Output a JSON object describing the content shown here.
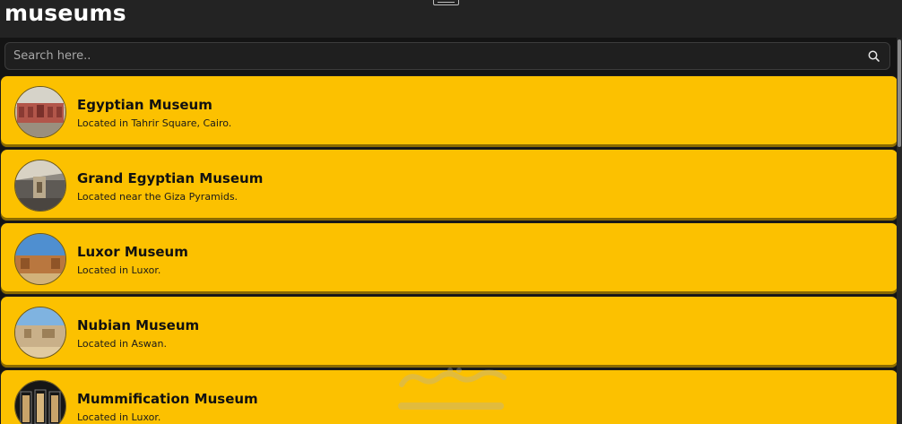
{
  "header": {
    "title": "museums",
    "menu_icon": "hamburger-menu-icon"
  },
  "search": {
    "placeholder": "Search here..",
    "value": "",
    "icon": "search-icon"
  },
  "museums": [
    {
      "name": "Egyptian Museum",
      "location": "Located in Tahrir Square, Cairo.",
      "image": "egyptian-museum-photo"
    },
    {
      "name": "Grand Egyptian Museum",
      "location": "Located near the Giza Pyramids.",
      "image": "grand-egyptian-museum-photo"
    },
    {
      "name": "Luxor Museum",
      "location": "Located in Luxor.",
      "image": "luxor-museum-photo"
    },
    {
      "name": "Nubian Museum",
      "location": "Located in Aswan.",
      "image": "nubian-museum-photo"
    },
    {
      "name": "Mummification Museum",
      "location": "Located in Luxor.",
      "image": "mummification-museum-photo"
    }
  ],
  "colors": {
    "card_background": "#fcc100",
    "header_background": "#232323",
    "page_background": "#141414"
  }
}
